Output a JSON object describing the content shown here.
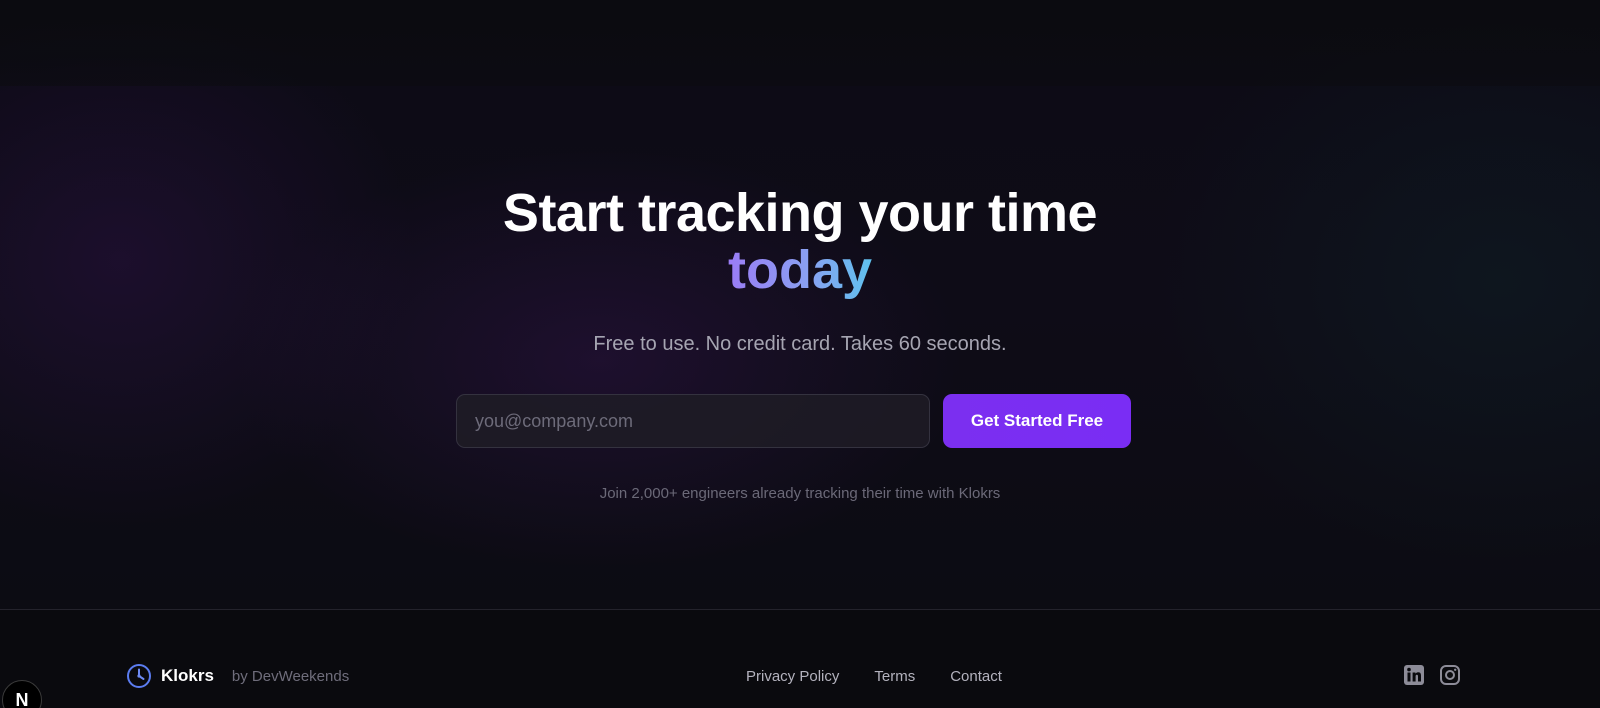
{
  "hero": {
    "headline": "Start tracking your time",
    "headline_accent": "today",
    "subtitle": "Free to use. No credit card. Takes 60 seconds.",
    "email_placeholder": "you@company.com",
    "email_value": "",
    "cta_label": "Get Started Free",
    "social_proof": "Join 2,000+ engineers already tracking their time with Klokrs"
  },
  "footer": {
    "brand_name": "Klokrs",
    "brand_by": "by DevWeekends",
    "brand_icon": "clock-icon",
    "links": [
      "Privacy Policy",
      "Terms",
      "Contact"
    ],
    "social": [
      "linkedin-icon",
      "instagram-icon"
    ]
  },
  "dev_badge": {
    "label": "N"
  },
  "colors": {
    "accent_purple": "#7b2ff0",
    "gradient_start": "#9a7cf5",
    "gradient_end": "#5fc2ee",
    "brand_icon": "#5b7cf0"
  }
}
